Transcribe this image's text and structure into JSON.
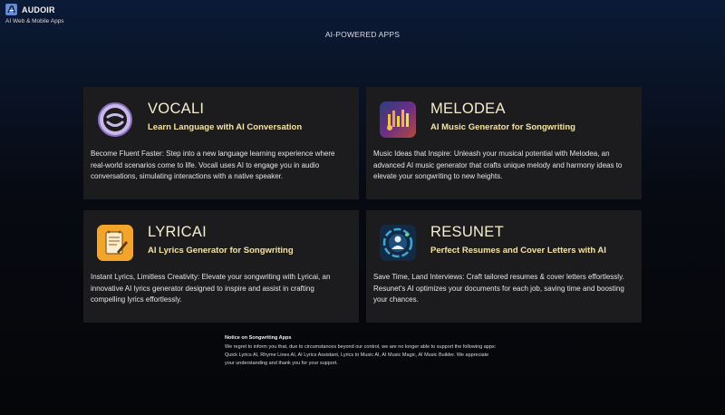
{
  "header": {
    "brand": "AUDOIR",
    "subtitle": "AI Web & Mobile Apps"
  },
  "section": {
    "title": "AI-POWERED APPS"
  },
  "apps": [
    {
      "name": "VOCALI",
      "tagline": "Learn Language with AI Conversation",
      "description": "Become Fluent Faster: Step into a new language learning experience where real-world scenarios come to life. Vocali uses AI to engage you in audio conversations, simulating interactions with a native speaker.",
      "icon": "vocali-logo-icon"
    },
    {
      "name": "MELODEA",
      "tagline": "AI Music Generator for Songwriting",
      "description": "Music Ideas that Inspire: Unleash your musical potential with Melodea, an advanced AI music generator that crafts unique melody and harmony ideas to elevate your songwriting to new heights.",
      "icon": "melodea-logo-icon"
    },
    {
      "name": "LYRICAI",
      "tagline": "AI Lyrics Generator for Songwriting",
      "description": "Instant Lyrics, Limitless Creativity: Elevate your songwriting with Lyricai, an innovative AI lyrics generator designed to inspire and assist in crafting compelling lyrics effortlessly.",
      "icon": "lyricai-logo-icon"
    },
    {
      "name": "RESUNET",
      "tagline": "Perfect Resumes and Cover Letters with AI",
      "description": "Save Time, Land Interviews: Craft tailored resumes & cover letters effortlessly. Resunet's AI optimizes your documents for each job, saving time and boosting your chances.",
      "icon": "resunet-logo-icon"
    }
  ],
  "notice": {
    "title": "Notice on Songwriting Apps",
    "text": "We regret to inform you that, due to circumstances beyond our control, we are no longer able to support the following apps: Quick Lyrics AI, Rhyme Lines AI, AI Lyrics Assistant, Lyrics to Music AI, AI Music Magic, AI Music Builder. We appreciate your understanding and thank you for your support."
  }
}
